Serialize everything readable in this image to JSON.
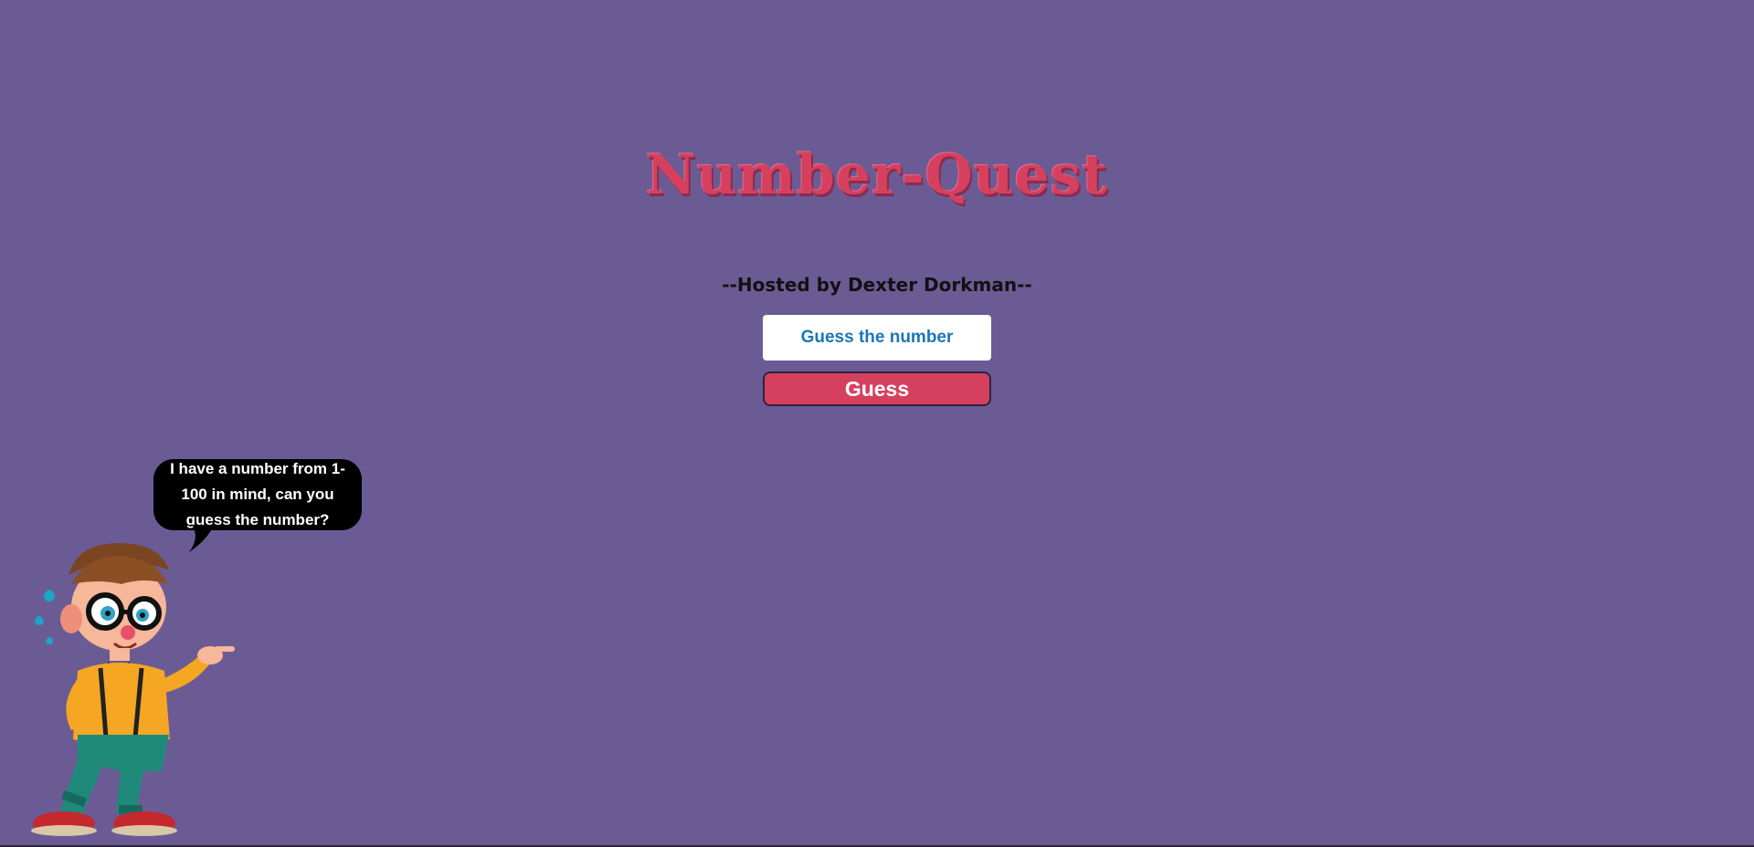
{
  "app": {
    "title": "Number-Quest",
    "subtitle": "--Hosted by Dexter Dorkman--"
  },
  "form": {
    "input_placeholder": "Guess the number",
    "input_value": "",
    "button_label": "Guess"
  },
  "mascot": {
    "speech": "I have a number from 1-100 in mind, can you guess the number?"
  },
  "colors": {
    "background": "#6b5b95",
    "accent": "#d6405f",
    "input_text": "#1b76b8"
  }
}
